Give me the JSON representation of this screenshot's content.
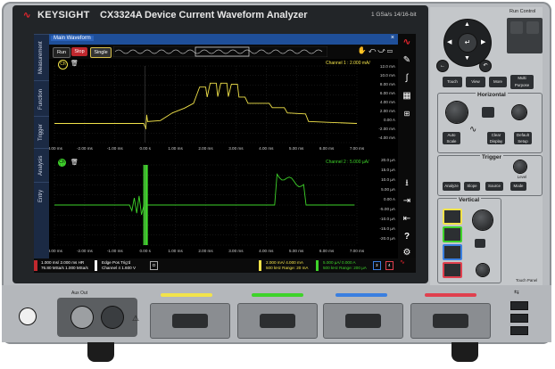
{
  "header": {
    "brand": "KEYSIGHT",
    "model": "CX3324A",
    "product_name": "Device Current Waveform Analyzer",
    "sample_rate": "1 GSa/s  14/16-bit"
  },
  "window": {
    "title": "Main Waveform",
    "side_tabs": [
      "Measurement",
      "Function",
      "Trigger",
      "Analysis",
      "Entry"
    ],
    "run_label": "Run",
    "stop_label": "Stop",
    "single_label": "Single"
  },
  "plot_top": {
    "channel_info": "Channel 1 : 2.000 mA/",
    "y_labels": [
      "12.0 mA",
      "10.0 mA",
      "8.00 mA",
      "6.00 mA",
      "4.00 mA",
      "2.00 mA",
      "0.00 A",
      "-2.00 mA",
      "-4.00 mA"
    ],
    "x_labels": [
      "-3.00 ms",
      "-2.00 ms",
      "-1.00 ms",
      "0.00 s",
      "1.00 ms",
      "2.00 ms",
      "3.00 ms",
      "4.00 ms",
      "5.00 ms",
      "6.00 ms",
      "7.00 ms"
    ],
    "trace_color": "#f2e34a"
  },
  "plot_bottom": {
    "channel_info": "Channel 2 : 5.000 µA/",
    "y_labels": [
      "20.0 µA",
      "15.0 µA",
      "10.0 µA",
      "5.00 µA",
      "0.00 A",
      "-5.00 µA",
      "-10.0 µA",
      "-15.0 µA",
      "-20.0 µA"
    ],
    "x_labels": [
      "-3.00 ms",
      "-2.00 ms",
      "-1.00 ms",
      "0.00 s",
      "1.00 ms",
      "2.00 ms",
      "3.00 ms",
      "4.00 ms",
      "5.00 ms",
      "6.00 ms",
      "7.00 ms"
    ],
    "trace_color": "#3ed32a"
  },
  "status": {
    "timebase_line1": "1.000 ms/   2.000 ms  HR",
    "timebase_line2": "76.80 MSa/s   1.000 MSa/s",
    "trigger_line1": "Edge  Pos        Trig'd",
    "trigger_line2": "Channel 4    1.600 V",
    "trigger_mode": "D",
    "ch1_line1": "2.000 mA/   4.000 mA",
    "ch1_line2": "500 kHz    Range: 20 mA",
    "ch2_line1": "5.000 µA/   0.000 A",
    "ch2_line2": "500 kHz    Range: 200 µA",
    "ch3_label": "3",
    "ch4_label": "4"
  },
  "front_panel": {
    "run_control": "Run Control",
    "touch_label": "Touch",
    "view_label": "View",
    "more_label": "More",
    "multi_purpose_label": "Multi Purpose",
    "horizontal_title": "Horizontal",
    "trigger_title": "Trigger",
    "vertical_title": "Vertical",
    "auto_scale": "Auto Scale",
    "clear_display": "Clear Display",
    "default_setup": "Default Setup",
    "analyze": "Analyze",
    "slope": "Slope",
    "source": "Source",
    "mode": "Mode",
    "level": "Level",
    "aux_out": "Aux Out",
    "touch_panel": "Touch Panel"
  },
  "colors": {
    "ch1": "#f2e34a",
    "ch2": "#3ed32a",
    "ch3": "#3a7fe0",
    "ch4": "#e0404e",
    "accent_red": "#e2252d"
  }
}
